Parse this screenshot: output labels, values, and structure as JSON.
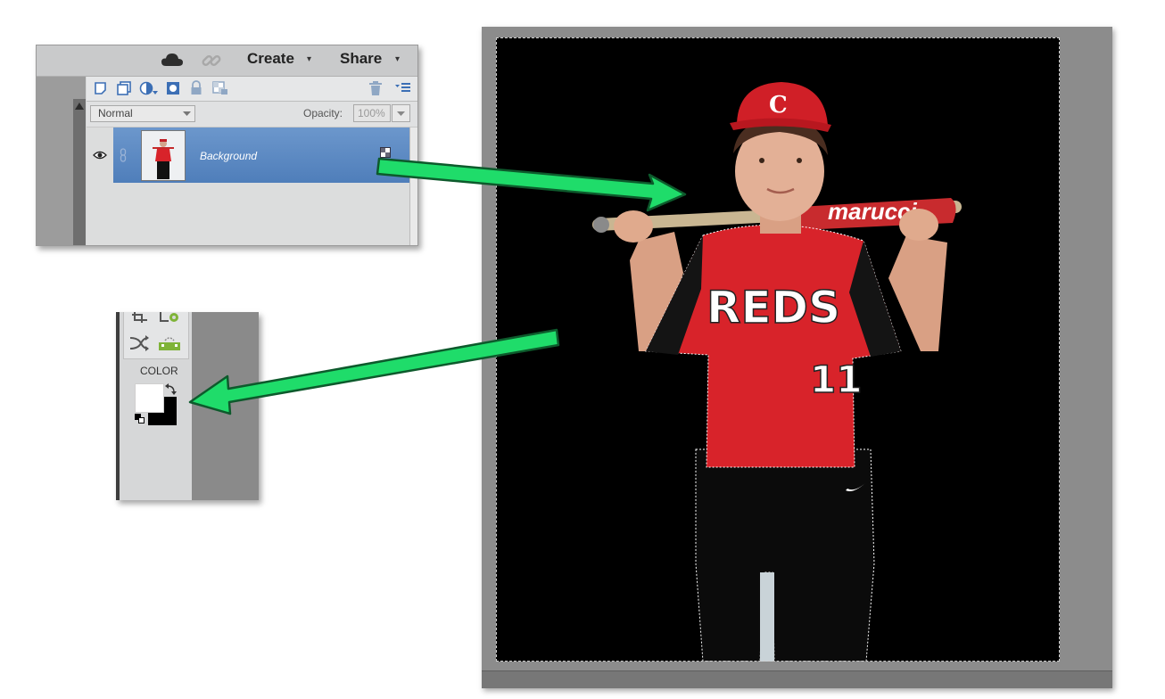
{
  "header": {
    "create_label": "Create",
    "share_label": "Share",
    "create_caret": "▾",
    "share_caret": "▾",
    "cloud_icon": "cloud-icon",
    "link_icon": "link-icon"
  },
  "layer_options": {
    "blend_mode": "Normal",
    "opacity_label": "Opacity:",
    "opacity_value": "100%"
  },
  "layers": [
    {
      "name": "Background",
      "visible": true
    }
  ],
  "tools": {
    "color_label": "COLOR",
    "foreground_color": "#ffffff",
    "background_color": "#000000"
  },
  "canvas": {
    "jersey_text": "REDS",
    "jersey_number": "11",
    "bat_brand": "marucci",
    "cap_letter": "C"
  },
  "colors": {
    "arrow": "#1fdc6a",
    "layer_highlight": "#5b89c4",
    "jersey_red": "#d8232a"
  }
}
